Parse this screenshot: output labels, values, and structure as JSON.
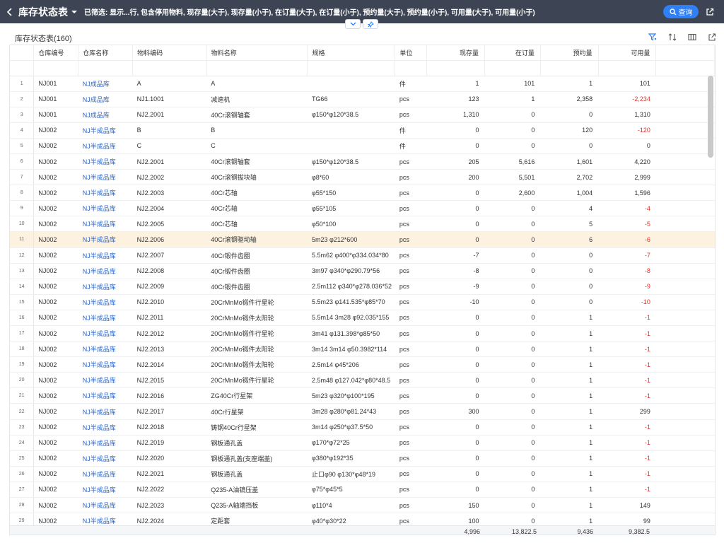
{
  "header": {
    "title": "库存状态表",
    "filter_text": "已筛选: 显示...行, 包含停用物料, 现存量(大于), 现存量(小于), 在订量(大于), 在订量(小于), 预约量(大于), 预约量(小于), 可用量(大于), 可用量(小于)",
    "query_label": "查询"
  },
  "subtitle": "库存状态表(160)",
  "colors": {
    "topbar": "#3d4453",
    "accent": "#2f7ff6",
    "link": "#2a63c6",
    "negative": "#e5322d",
    "selected_row": "#fdf2e0"
  },
  "icons": [
    "back-icon",
    "caret-down-icon",
    "search-icon",
    "export-icon",
    "chevron-down-icon",
    "pin-icon",
    "filter-icon",
    "sort-icon",
    "columns-icon"
  ],
  "columns": [
    "仓库编号",
    "仓库名称",
    "物料编码",
    "物料名称",
    "规格",
    "单位",
    "现存量",
    "在订量",
    "预约量",
    "可用量"
  ],
  "rows": [
    [
      "1",
      "NJ001",
      "NJ成品库",
      "A",
      "A",
      "",
      "件",
      "1",
      "101",
      "1",
      "101"
    ],
    [
      "2",
      "NJ001",
      "NJ成品库",
      "NJ1.1001",
      "减速机",
      "TG66",
      "pcs",
      "123",
      "1",
      "2,358",
      "-2,234"
    ],
    [
      "3",
      "NJ001",
      "NJ成品库",
      "NJ2.2001",
      "40Cr滚钢轴套",
      "φ150*φ120*38.5",
      "pcs",
      "1,310",
      "0",
      "0",
      "1,310"
    ],
    [
      "4",
      "NJ002",
      "NJ半成品库",
      "B",
      "B",
      "",
      "件",
      "0",
      "0",
      "120",
      "-120"
    ],
    [
      "5",
      "NJ002",
      "NJ半成品库",
      "C",
      "C",
      "",
      "件",
      "0",
      "0",
      "0",
      "0"
    ],
    [
      "6",
      "NJ002",
      "NJ半成品库",
      "NJ2.2001",
      "40Cr滚钢轴套",
      "φ150*φ120*38.5",
      "pcs",
      "205",
      "5,616",
      "1,601",
      "4,220"
    ],
    [
      "7",
      "NJ002",
      "NJ半成品库",
      "NJ2.2002",
      "40Cr滚钢拔块轴",
      "φ8*60",
      "pcs",
      "200",
      "5,501",
      "2,702",
      "2,999"
    ],
    [
      "8",
      "NJ002",
      "NJ半成品库",
      "NJ2.2003",
      "40Cr芯轴",
      "φ55*150",
      "pcs",
      "0",
      "2,600",
      "1,004",
      "1,596"
    ],
    [
      "9",
      "NJ002",
      "NJ半成品库",
      "NJ2.2004",
      "40Cr芯轴",
      "φ55*105",
      "pcs",
      "0",
      "0",
      "4",
      "-4"
    ],
    [
      "10",
      "NJ002",
      "NJ半成品库",
      "NJ2.2005",
      "40Cr芯轴",
      "φ50*100",
      "pcs",
      "0",
      "0",
      "5",
      "-5"
    ],
    [
      "11",
      "NJ002",
      "NJ半成品库",
      "NJ2.2006",
      "40Cr滚钢驱动轴",
      "5m23 φ212*600",
      "pcs",
      "0",
      "0",
      "6",
      "-6"
    ],
    [
      "12",
      "NJ002",
      "NJ半成品库",
      "NJ2.2007",
      "40Cr锻件齿圈",
      "5.5m62 φ400*φ334.034*80",
      "pcs",
      "-7",
      "0",
      "0",
      "-7"
    ],
    [
      "13",
      "NJ002",
      "NJ半成品库",
      "NJ2.2008",
      "40Cr锻件齿圈",
      "3m97 φ340*φ290.79*56",
      "pcs",
      "-8",
      "0",
      "0",
      "-8"
    ],
    [
      "14",
      "NJ002",
      "NJ半成品库",
      "NJ2.2009",
      "40Cr锻件齿圈",
      "2.5m112 φ340*φ278.036*52",
      "pcs",
      "-9",
      "0",
      "0",
      "-9"
    ],
    [
      "15",
      "NJ002",
      "NJ半成品库",
      "NJ2.2010",
      "20CrMnMo锻件行星轮",
      "5.5m23 φ141.535*φ85*70",
      "pcs",
      "-10",
      "0",
      "0",
      "-10"
    ],
    [
      "16",
      "NJ002",
      "NJ半成品库",
      "NJ2.2011",
      "20CrMnMo锻件太阳轮",
      "5.5m14 3m28 φ92.035*155",
      "pcs",
      "0",
      "0",
      "1",
      "-1"
    ],
    [
      "17",
      "NJ002",
      "NJ半成品库",
      "NJ2.2012",
      "20CrMnMo锻件行星轮",
      "3m41 φ131.398*φ85*50",
      "pcs",
      "0",
      "0",
      "1",
      "-1"
    ],
    [
      "18",
      "NJ002",
      "NJ半成品库",
      "NJ2.2013",
      "20CrMnMo锻件太阳轮",
      "3m14 3m14 φ50.3982*114",
      "pcs",
      "0",
      "0",
      "1",
      "-1"
    ],
    [
      "19",
      "NJ002",
      "NJ半成品库",
      "NJ2.2014",
      "20CrMnMo锻件太阳轮",
      "2.5m14 φ45*206",
      "pcs",
      "0",
      "0",
      "1",
      "-1"
    ],
    [
      "20",
      "NJ002",
      "NJ半成品库",
      "NJ2.2015",
      "20CrMnMo锻件行星轮",
      "2.5m48 φ127.042*φ80*48.5",
      "pcs",
      "0",
      "0",
      "1",
      "-1"
    ],
    [
      "21",
      "NJ002",
      "NJ半成品库",
      "NJ2.2016",
      "ZG40Cr行星架",
      "5m23 φ320*φ100*195",
      "pcs",
      "0",
      "0",
      "1",
      "-1"
    ],
    [
      "22",
      "NJ002",
      "NJ半成品库",
      "NJ2.2017",
      "40Cr行星架",
      "3m28 φ280*φ81.24*43",
      "pcs",
      "300",
      "0",
      "1",
      "299"
    ],
    [
      "23",
      "NJ002",
      "NJ半成品库",
      "NJ2.2018",
      "铸钢40Cr行星架",
      "3m14 φ250*φ37.5*50",
      "pcs",
      "0",
      "0",
      "1",
      "-1"
    ],
    [
      "24",
      "NJ002",
      "NJ半成品库",
      "NJ2.2019",
      "钢板通孔盖",
      "φ170*φ72*25",
      "pcs",
      "0",
      "0",
      "1",
      "-1"
    ],
    [
      "25",
      "NJ002",
      "NJ半成品库",
      "NJ2.2020",
      "钢板通孔盖(支座端盖)",
      "φ380*φ192*35",
      "pcs",
      "0",
      "0",
      "1",
      "-1"
    ],
    [
      "26",
      "NJ002",
      "NJ半成品库",
      "NJ2.2021",
      "钢板通孔盖",
      "止口φ90 φ130*φ48*19",
      "pcs",
      "0",
      "0",
      "1",
      "-1"
    ],
    [
      "27",
      "NJ002",
      "NJ半成品库",
      "NJ2.2022",
      "Q235-A油镜压盖",
      "φ75*φ45*5",
      "pcs",
      "0",
      "0",
      "1",
      "-1"
    ],
    [
      "28",
      "NJ002",
      "NJ半成品库",
      "NJ2.2023",
      "Q235-A轴端挡板",
      "φ110*4",
      "pcs",
      "150",
      "0",
      "1",
      "149"
    ],
    [
      "29",
      "NJ002",
      "NJ半成品库",
      "NJ2.2024",
      "定距套",
      "φ40*φ30*22",
      "pcs",
      "100",
      "0",
      "1",
      "99"
    ]
  ],
  "totals": {
    "onhand": "4,996",
    "onorder": "13,822.5",
    "reserved": "9,436",
    "available": "9,382.5"
  }
}
